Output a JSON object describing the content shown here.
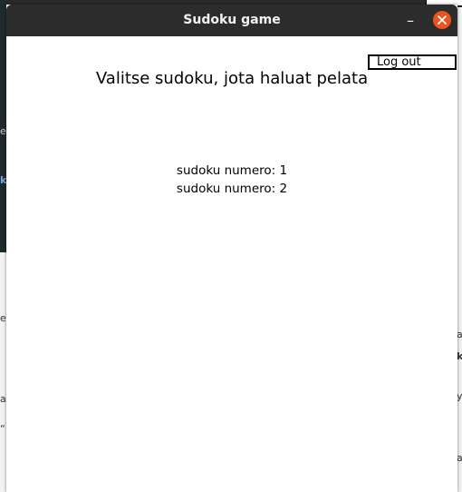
{
  "window": {
    "title": "Sudoku game",
    "minimize_glyph": "–",
    "close_icon": "close-icon",
    "accent_close": "#e95420",
    "titlebar_color": "#2c2c2c"
  },
  "header": {
    "logout_label": "Log out",
    "heading": "Valitse sudoku, jota haluat pelata"
  },
  "sudoku_list": [
    {
      "label": "sudoku numero: 1"
    },
    {
      "label": "sudoku numero: 2"
    }
  ],
  "background": {
    "fragments": [
      "e",
      "k",
      "e",
      "a",
      "“",
      "a",
      "k",
      "y",
      "a"
    ]
  }
}
